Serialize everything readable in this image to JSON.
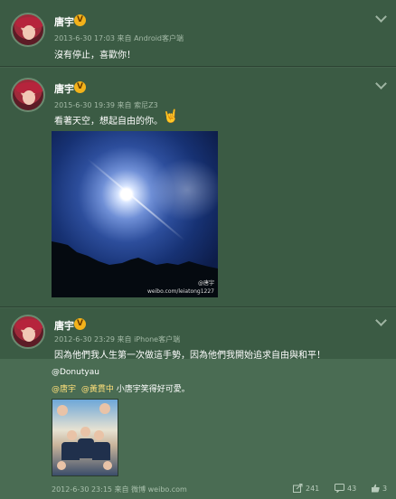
{
  "posts": [
    {
      "username": "唐宇",
      "verified_badge": "V",
      "meta": "2013-6-30 17:03 来自 Android客户端",
      "text": "沒有停止，喜歡你！"
    },
    {
      "username": "唐宇",
      "verified_badge": "V",
      "meta": "2015-6-30 19:39 来自 索尼Z3",
      "text": "看著天空，想起自由的你。",
      "image_watermark_name": "@唐宇",
      "image_watermark_url": "weibo.com/leiatong1227"
    },
    {
      "username": "唐宇",
      "verified_badge": "V",
      "meta": "2012-6-30 23:29 来自 iPhone客户端",
      "text": "因為他們我人生第一次做這手勢，因為他們我開始追求自由與和平！",
      "repost": {
        "author": "@Donutyau",
        "mention_1": "@唐宇",
        "mention_2": "@黃貫中",
        "text": " 小唐宇笑得好可愛。",
        "meta": "2012-6-30 23:15 来自 微博 weibo.com"
      },
      "actions": {
        "repost_count": "241",
        "comment_count": "43",
        "like_count": "3"
      }
    }
  ],
  "colors": {
    "background": "#3b5b44",
    "repost_background": "#4a6c53",
    "badge": "#f3b21a",
    "meta": "#a3b9a6"
  }
}
